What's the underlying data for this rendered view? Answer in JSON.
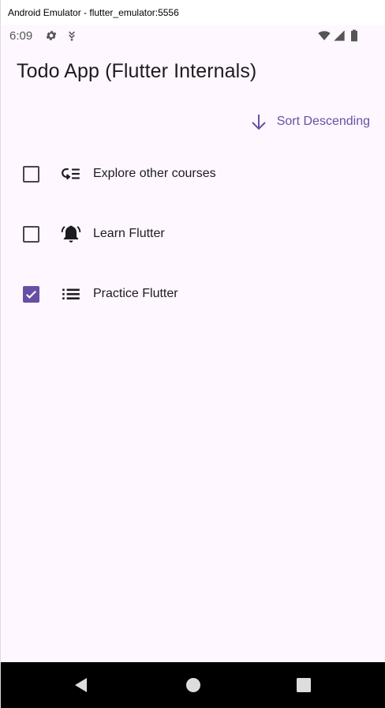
{
  "window": {
    "title": "Android Emulator - flutter_emulator:5556"
  },
  "status_bar": {
    "time": "6:09",
    "icons": [
      "gear-icon",
      "download-icon",
      "wifi-icon",
      "signal-icon",
      "battery-icon"
    ]
  },
  "app": {
    "title": "Todo App (Flutter Internals)"
  },
  "sort": {
    "label": "Sort Descending",
    "icon": "arrow-down-icon"
  },
  "todos": [
    {
      "label": "Explore other courses",
      "checked": false,
      "icon": "playlist-icon"
    },
    {
      "label": "Learn Flutter",
      "checked": false,
      "icon": "bell-icon"
    },
    {
      "label": "Practice Flutter",
      "checked": true,
      "icon": "list-icon"
    }
  ],
  "nav_bar": {
    "buttons": [
      "back-icon",
      "home-icon",
      "recents-icon"
    ]
  },
  "colors": {
    "accent": "#6750a4",
    "background": "#fef7ff",
    "text": "#1d1b20"
  }
}
